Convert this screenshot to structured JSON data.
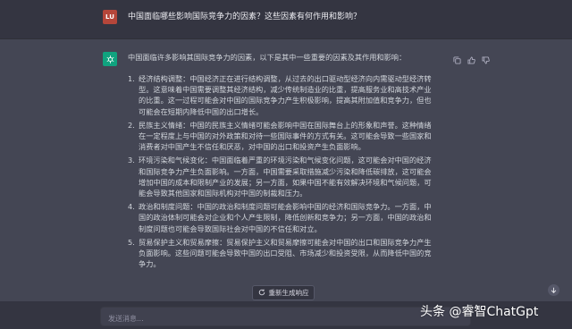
{
  "user_message": {
    "avatar_initials": "LU",
    "text": "中国面临哪些影响国际竞争力的因素？这些因素有何作用和影响？"
  },
  "assistant_message": {
    "intro": "中国面临许多影响其国际竞争力的因素，以下是其中一些重要的因素及其作用和影响：",
    "items": [
      {
        "num": "1.",
        "text": "经济结构调整：中国经济正在进行结构调整，从过去的出口驱动型经济向内需驱动型经济转型。这意味着中国需要调整其经济结构，减少传统制造业的比重，提高服务业和高技术产业的比重。这一过程可能会对中国的国际竞争力产生积极影响，提高其附加值和竞争力，但也可能会在短期内降低中国的出口增长。"
      },
      {
        "num": "2.",
        "text": "民族主义情绪：中国的民族主义情绪可能会影响中国在国际舞台上的形象和声誉。这种情绪在一定程度上与中国的对外政策和对待一些国际事件的方式有关。这可能会导致一些国家和消费者对中国产生不信任和厌恶，对中国的出口和投资产生负面影响。"
      },
      {
        "num": "3.",
        "text": "环境污染和气候变化：中国面临着严重的环境污染和气候变化问题，这可能会对中国的经济和国际竞争力产生负面影响。一方面，中国需要采取措施减少污染和降低碳排放，这可能会增加中国的成本和限制产业的发展；另一方面，如果中国不能有效解决环境和气候问题，可能会导致其他国家和国际机构对中国的制裁和压力。"
      },
      {
        "num": "4.",
        "text": "政治和制度问题：中国的政治和制度问题可能会影响中国的经济和国际竞争力。一方面，中国的政治体制可能会对企业和个人产生限制，降低创新和竞争力；另一方面，中国的政治和制度问题也可能会导致国际社会对中国的不信任和对立。"
      },
      {
        "num": "5.",
        "text": "贸易保护主义和贸易摩擦：贸易保护主义和贸易摩擦可能会对中国的出口和国际竞争力产生负面影响。这些问题可能会导致中国的出口受阻、市场减少和投资受限，从而降低中国的竞争力。"
      }
    ]
  },
  "regenerate_label": "重新生成响应",
  "input": {
    "placeholder": "发送消息..."
  },
  "watermark": "头条 @睿智ChatGpt",
  "colors": {
    "background": "#444654",
    "user_row": "#343541",
    "accent": "#10a37f",
    "user_avatar": "#b5463a"
  }
}
